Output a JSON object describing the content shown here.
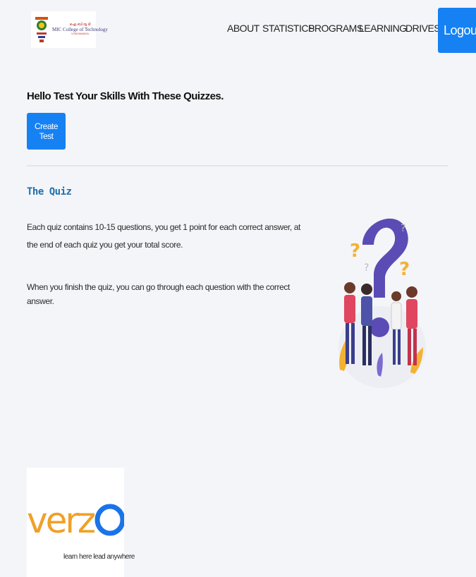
{
  "header": {
    "logo": {
      "top_line": "ഐ.ബി.യു.ടി",
      "name": "MIC College of Technology",
      "sub_line": "VIJAYAWADA"
    },
    "nav_items": [
      "ABOUT",
      "STATISTICS",
      "PROGRAMS",
      "LEARNING",
      "DRIVES"
    ],
    "logout_label": "Logout",
    "accent_color": "#1681f3"
  },
  "main": {
    "greeting": "Hello Test Your Skills With These Quizzes.",
    "create_test_label": "Create Test",
    "quiz": {
      "title": "The Quiz",
      "paragraph_1": "Each quiz contains 10-15 questions, you get 1 point for each correct answer, at the end of each quiz you get your total score.",
      "paragraph_2": "When you finish the quiz, you can go through each question with the correct answer.",
      "illustration": "people-question-mark-illustration"
    }
  },
  "partner": {
    "logo_text": "verzeo",
    "tagline": "learn here lead anywhere"
  }
}
